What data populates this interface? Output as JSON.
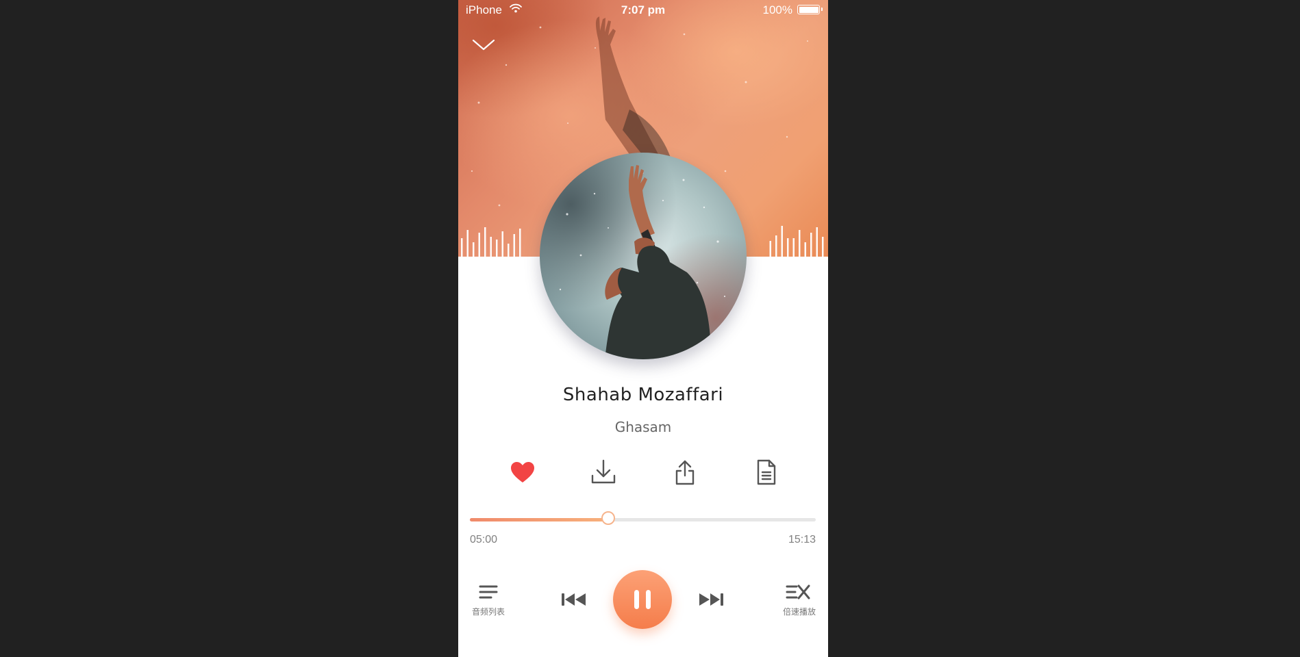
{
  "status_bar": {
    "carrier": "iPhone",
    "time": "7:07 pm",
    "battery_percent": "100%"
  },
  "track": {
    "title": "Shahab Mozaffari",
    "artist": "Ghasam"
  },
  "actions": {
    "like_icon": "heart-icon",
    "download_icon": "download-icon",
    "share_icon": "share-icon",
    "lyrics_icon": "document-icon",
    "liked": true
  },
  "progress": {
    "elapsed": "05:00",
    "total": "15:13",
    "fraction": 0.4
  },
  "controls": {
    "playlist_label": "音频列表",
    "speed_label": "倍速播放",
    "prev_icon": "skip-previous-icon",
    "next_icon": "skip-next-icon",
    "play_state": "playing"
  },
  "colors": {
    "accent": "#f68a5a",
    "like": "#f24444",
    "icon": "#555555"
  }
}
